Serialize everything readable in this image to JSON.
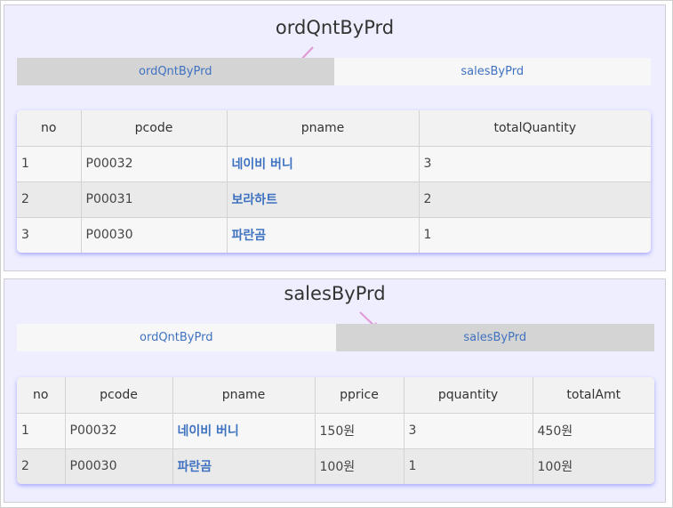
{
  "colors": {
    "panel_bg": "#eeeeff",
    "tab_active": "#d4d4d4",
    "tab_inactive": "#f7f7f7",
    "link": "#3f72c0",
    "arrow": "#e39ad8",
    "table_shadow": "#6e6eff"
  },
  "section1": {
    "title": "ordQntByPrd",
    "tabs": [
      {
        "label": "ordQntByPrd",
        "active": true
      },
      {
        "label": "salesByPrd",
        "active": false
      }
    ],
    "headers": [
      "no",
      "pcode",
      "pname",
      "totalQuantity"
    ],
    "rows": [
      {
        "no": "1",
        "pcode": "P00032",
        "pname": "네이비 버니",
        "totalQuantity": "3"
      },
      {
        "no": "2",
        "pcode": "P00031",
        "pname": "보라하트",
        "totalQuantity": "2"
      },
      {
        "no": "3",
        "pcode": "P00030",
        "pname": "파란곰",
        "totalQuantity": "1"
      }
    ]
  },
  "section2": {
    "title": "salesByPrd",
    "tabs": [
      {
        "label": "ordQntByPrd",
        "active": false
      },
      {
        "label": "salesByPrd",
        "active": true
      }
    ],
    "headers": [
      "no",
      "pcode",
      "pname",
      "pprice",
      "pquantity",
      "totalAmt"
    ],
    "rows": [
      {
        "no": "1",
        "pcode": "P00032",
        "pname": "네이비 버니",
        "pprice": "150원",
        "pquantity": "3",
        "totalAmt": "450원"
      },
      {
        "no": "2",
        "pcode": "P00030",
        "pname": "파란곰",
        "pprice": "100원",
        "pquantity": "1",
        "totalAmt": "100원"
      }
    ]
  }
}
